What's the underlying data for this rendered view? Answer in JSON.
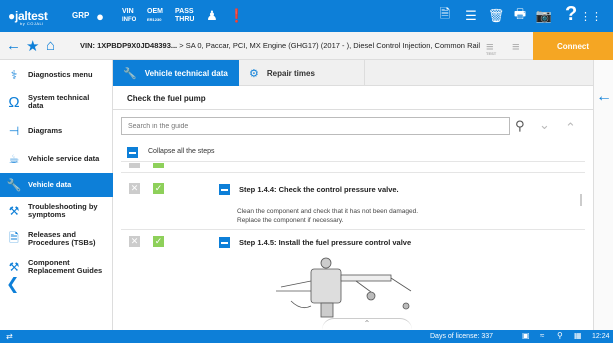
{
  "topbar": {
    "logo_text": "jaltest",
    "logo_sub": "by COJALI",
    "grp_label": "GRP",
    "vin_top": "VIN",
    "vin_bottom": "INFO",
    "oem_top": "OEM",
    "oem_bottom": "ER1230",
    "pass_top": "PASS",
    "pass_bottom": "THRU",
    "help_label": "?"
  },
  "vinbar": {
    "vin_label": "VIN:",
    "vin_value": "1XPBDP9X0JD48393...",
    "vehicle_path": " > SA 0, Paccar, PCI, MX Engine (GHG17) (2017 - ), Diesel Control Injection, Common Rail",
    "connect_label": "Connect",
    "test_label": "TEST"
  },
  "sidebar": {
    "items": [
      {
        "label": "Diagnostics menu",
        "icon": "stethoscope-icon"
      },
      {
        "label": "System technical data",
        "icon": "ohm-icon"
      },
      {
        "label": "Diagrams",
        "icon": "diagram-icon"
      },
      {
        "label": "Vehicle service data",
        "icon": "oil-can-icon"
      },
      {
        "label": "Vehicle data",
        "icon": "wrench-icon"
      },
      {
        "label": "Troubleshooting by symptoms",
        "icon": "tools-icon"
      },
      {
        "label": "Releases and Procedures (TSBs)",
        "icon": "document-icon"
      },
      {
        "label": "Component Replacement Guides",
        "icon": "wrenches-icon"
      }
    ]
  },
  "tabs": [
    {
      "label": "Vehicle technical data",
      "icon": "wrench-icon"
    },
    {
      "label": "Repair times",
      "icon": "gear-clock-icon"
    }
  ],
  "content": {
    "title": "Check the fuel pump",
    "search_placeholder": "Search in the guide",
    "collapse_label": "Collapse all the steps"
  },
  "steps": [
    {
      "title": "Step 1.4.4: Check the control pressure valve.",
      "desc_line1": "Clean the component and check that it has not been damaged.",
      "desc_line2": "Replace the component if necessary."
    },
    {
      "title": "Step 1.4.5: Install the fuel pressure control valve"
    }
  ],
  "statusbar": {
    "days_label": "Days of license: 337",
    "time": "12:24"
  },
  "colors": {
    "accent": "#0d7fd8",
    "connect": "#f5a623",
    "check_green": "#8ed05a"
  }
}
